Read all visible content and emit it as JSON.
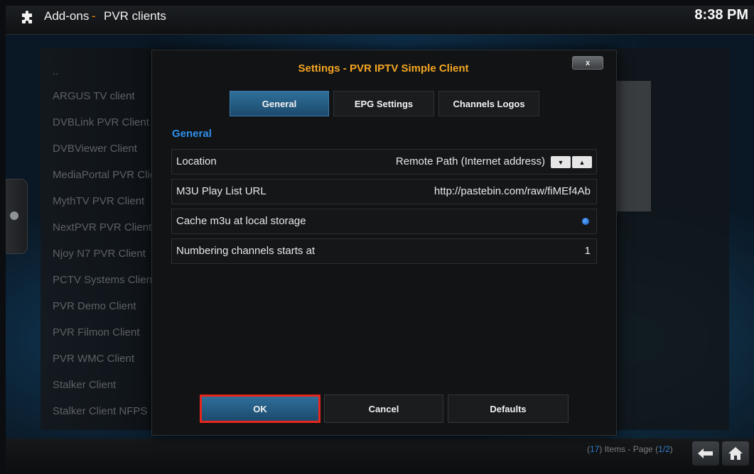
{
  "header": {
    "root": "Add-ons",
    "separator": "-",
    "page": "PVR clients",
    "clock": "8:38 PM"
  },
  "addon_list": {
    "items": [
      "..",
      "ARGUS TV client",
      "DVBLink PVR Client",
      "DVBViewer Client",
      "MediaPortal PVR Client",
      "MythTV PVR Client",
      "NextPVR PVR Client",
      "Njoy N7 PVR Client",
      "PCTV Systems Client",
      "PVR Demo Client",
      "PVR Filmon Client",
      "PVR WMC Client",
      "Stalker Client",
      "Stalker Client NFPS"
    ]
  },
  "dialog": {
    "title": "Settings - PVR IPTV Simple Client",
    "close_label": "x",
    "tabs": [
      "General",
      "EPG Settings",
      "Channels Logos"
    ],
    "active_tab": "General",
    "section": "General",
    "settings": [
      {
        "label": "Location",
        "value": "Remote Path (Internet address)"
      },
      {
        "label": "M3U Play List URL",
        "value": "http://pastebin.com/raw/fiMEf4Ab"
      },
      {
        "label": "Cache m3u at local storage",
        "value": ""
      },
      {
        "label": "Numbering channels starts at",
        "value": "1"
      }
    ],
    "spin_down": "▼",
    "spin_up": "▲",
    "buttons": {
      "ok": "OK",
      "cancel": "Cancel",
      "defaults": "Defaults"
    }
  },
  "footer": {
    "count": "17",
    "items_text": "Items - Page",
    "page": "1/2"
  },
  "colors": {
    "accent_orange": "#f5a623",
    "accent_blue": "#2f8fe8",
    "highlight_red": "#e8261c"
  }
}
